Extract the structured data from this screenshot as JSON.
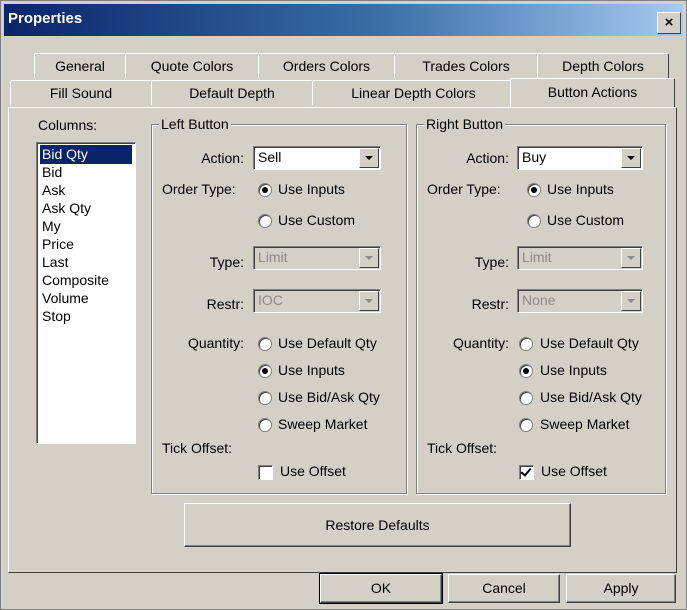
{
  "window": {
    "title": "Properties",
    "close_label": "×"
  },
  "tabs_row1": [
    "General",
    "Quote Colors",
    "Orders Colors",
    "Trades Colors",
    "Depth Colors"
  ],
  "tabs_row2": [
    "Fill Sound",
    "Default Depth",
    "Linear Depth Colors",
    "Button Actions"
  ],
  "active_tab": "Button Actions",
  "columns": {
    "label": "Columns:",
    "items": [
      "Bid Qty",
      "Bid",
      "Ask",
      "Ask Qty",
      "My",
      "Price",
      "Last",
      "Composite",
      "Volume",
      "Stop"
    ],
    "selected": "Bid Qty"
  },
  "labels": {
    "action": "Action:",
    "order_type": "Order Type:",
    "type": "Type:",
    "restr": "Restr:",
    "quantity": "Quantity:",
    "tick_offset": "Tick Offset:",
    "use_inputs": "Use Inputs",
    "use_custom": "Use Custom",
    "use_default_qty": "Use Default Qty",
    "use_bid_ask_qty": "Use Bid/Ask Qty",
    "sweep_market": "Sweep Market",
    "use_offset": "Use Offset"
  },
  "left": {
    "title": "Left Button",
    "action": "Sell",
    "type": "Limit",
    "restr": "IOC",
    "order_type": "Use Inputs",
    "quantity": "Use Inputs",
    "use_offset": false
  },
  "right": {
    "title": "Right Button",
    "action": "Buy",
    "type": "Limit",
    "restr": "None",
    "order_type": "Use Inputs",
    "quantity": "Use Inputs",
    "use_offset": true
  },
  "buttons": {
    "restore": "Restore Defaults",
    "ok": "OK",
    "cancel": "Cancel",
    "apply": "Apply"
  }
}
